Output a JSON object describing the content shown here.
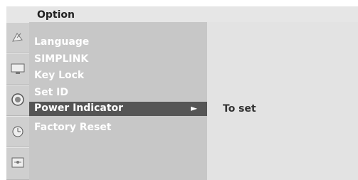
{
  "header": {
    "title": "Option"
  },
  "menu": {
    "items": [
      {
        "label": "Language"
      },
      {
        "label": "SIMPLINK"
      },
      {
        "label": "Key Lock"
      },
      {
        "label": "Set ID"
      },
      {
        "label": "Power Indicator"
      },
      {
        "label": "Factory Reset"
      }
    ],
    "selected_index": 4,
    "arrow_glyph": "►"
  },
  "detail": {
    "value": "To set"
  },
  "icons": [
    "satellite-dish-icon",
    "tv-screen-icon",
    "speaker-icon",
    "clock-icon",
    "option-settings-icon"
  ],
  "colors": {
    "header_bg": "#e6e6e6",
    "menu_bg": "#c7c7c7",
    "selected_bg": "#555555",
    "detail_bg": "#e3e3e3"
  }
}
